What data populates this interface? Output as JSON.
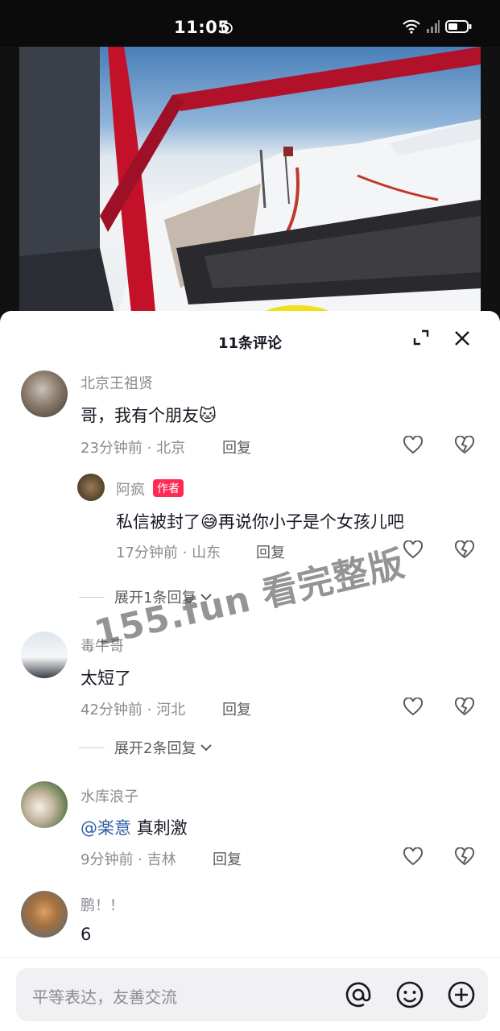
{
  "status_bar": {
    "time": "11:05"
  },
  "sheet": {
    "title": "11条评论"
  },
  "comments": [
    {
      "user": "北京王祖贤",
      "text": "哥，我有个朋友",
      "emoji": "🐱",
      "time": "23分钟前",
      "location": "北京",
      "reply_label": "回复",
      "sub": {
        "user": "阿疯",
        "badge": "作者",
        "text_before": "私信被封了",
        "emoji": "😅",
        "text_after": "再说你小子是个女孩儿吧",
        "time": "17分钟前",
        "location": "山东",
        "reply_label": "回复"
      },
      "expand": "展开1条回复"
    },
    {
      "user": "毒牛哥",
      "text": "太短了",
      "time": "42分钟前",
      "location": "河北",
      "reply_label": "回复",
      "expand": "展开2条回复"
    },
    {
      "user": "水库浪子",
      "mention": "@楽意",
      "text": " 真刺激",
      "time": "9分钟前",
      "location": "吉林",
      "reply_label": "回复"
    },
    {
      "user": "鹏！！",
      "text": "6"
    }
  ],
  "watermark": "155.fun 看完整版",
  "input": {
    "placeholder": "平等表达，友善交流"
  },
  "colors": {
    "accent": "#fe2c55",
    "mention": "#2f5fa3"
  }
}
